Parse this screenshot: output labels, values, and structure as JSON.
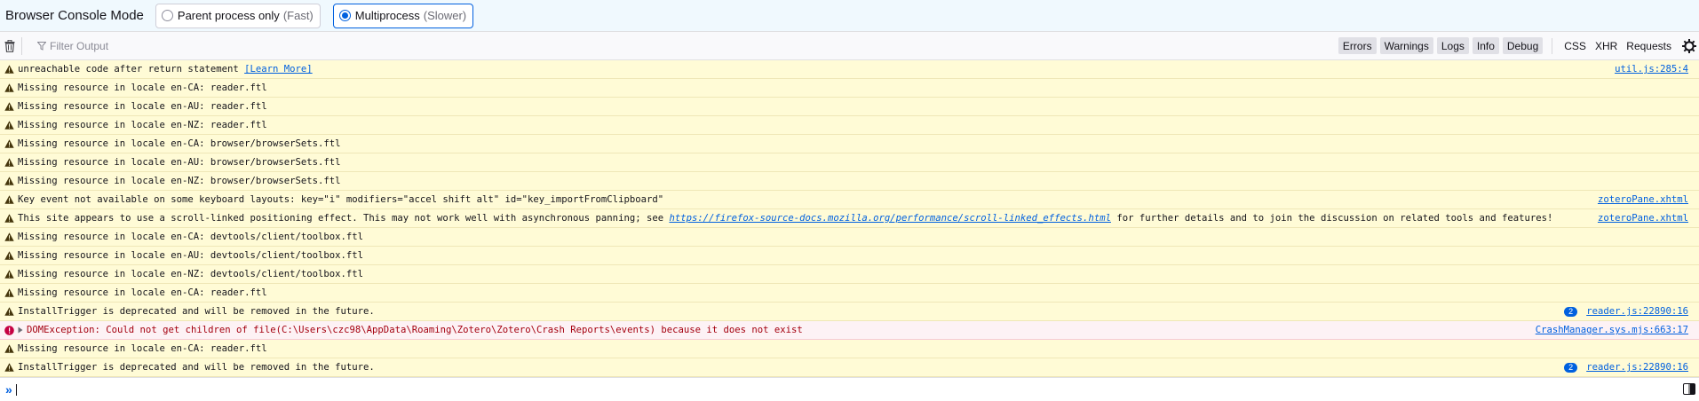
{
  "mode_bar": {
    "title": "Browser Console Mode",
    "options": [
      {
        "label": "Parent process only",
        "hint": "(Fast)",
        "selected": false
      },
      {
        "label": "Multiprocess",
        "hint": "(Slower)",
        "selected": true
      }
    ]
  },
  "toolbar": {
    "filter_placeholder": "Filter Output",
    "levels": [
      "Errors",
      "Warnings",
      "Logs",
      "Info",
      "Debug"
    ],
    "types": [
      "CSS",
      "XHR",
      "Requests"
    ],
    "icons": [
      "trash-icon",
      "filter-icon",
      "gear-icon"
    ]
  },
  "messages": [
    {
      "level": "warning",
      "text": "unreachable code after return statement ",
      "link": "[Learn More]",
      "source": "util.js:285:4",
      "count": ""
    },
    {
      "level": "warning",
      "text": "Missing resource in locale en-CA: reader.ftl",
      "source": "",
      "count": ""
    },
    {
      "level": "warning",
      "text": "Missing resource in locale en-AU: reader.ftl",
      "source": "",
      "count": ""
    },
    {
      "level": "warning",
      "text": "Missing resource in locale en-NZ: reader.ftl",
      "source": "",
      "count": ""
    },
    {
      "level": "warning",
      "text": "Missing resource in locale en-CA: browser/browserSets.ftl",
      "source": "",
      "count": ""
    },
    {
      "level": "warning",
      "text": "Missing resource in locale en-AU: browser/browserSets.ftl",
      "source": "",
      "count": ""
    },
    {
      "level": "warning",
      "text": "Missing resource in locale en-NZ: browser/browserSets.ftl",
      "source": "",
      "count": ""
    },
    {
      "level": "warning",
      "text": "Key event not available on some keyboard layouts: key=\"i\" modifiers=\"accel shift alt\" id=\"key_importFromClipboard\"",
      "source": "zoteroPane.xhtml",
      "count": ""
    },
    {
      "level": "warning",
      "text": "This site appears to use a scroll-linked positioning effect. This may not work well with asynchronous panning; see ",
      "url": "https://firefox-source-docs.mozilla.org/performance/scroll-linked_effects.html",
      "text_after": " for further details and to join the discussion on related tools and features!",
      "source": "zoteroPane.xhtml",
      "count": ""
    },
    {
      "level": "warning",
      "text": "Missing resource in locale en-CA: devtools/client/toolbox.ftl",
      "source": "",
      "count": ""
    },
    {
      "level": "warning",
      "text": "Missing resource in locale en-AU: devtools/client/toolbox.ftl",
      "source": "",
      "count": ""
    },
    {
      "level": "warning",
      "text": "Missing resource in locale en-NZ: devtools/client/toolbox.ftl",
      "source": "",
      "count": ""
    },
    {
      "level": "warning",
      "text": "Missing resource in locale en-CA: reader.ftl",
      "source": "",
      "count": ""
    },
    {
      "level": "warning",
      "text": "InstallTrigger is deprecated and will be removed in the future.",
      "source": "reader.js:22890:16",
      "count": "2"
    },
    {
      "level": "error",
      "text": "DOMException: Could not get children of file(C:\\Users\\czc98\\AppData\\Roaming\\Zotero\\Zotero\\Crash Reports\\events) because it does not exist",
      "source": "CrashManager.sys.mjs:663:17",
      "count": ""
    },
    {
      "level": "warning",
      "text": "Missing resource in locale en-CA: reader.ftl",
      "source": "",
      "count": ""
    },
    {
      "level": "warning",
      "text": "InstallTrigger is deprecated and will be removed in the future.",
      "source": "reader.js:22890:16",
      "count": "2"
    }
  ],
  "input": {
    "prompt": "»",
    "value": ""
  },
  "colors": {
    "accent": "#0060df",
    "warning_bg": "#fffbd6",
    "error_bg": "#fdf2f5",
    "error_text": "#a4000f"
  }
}
